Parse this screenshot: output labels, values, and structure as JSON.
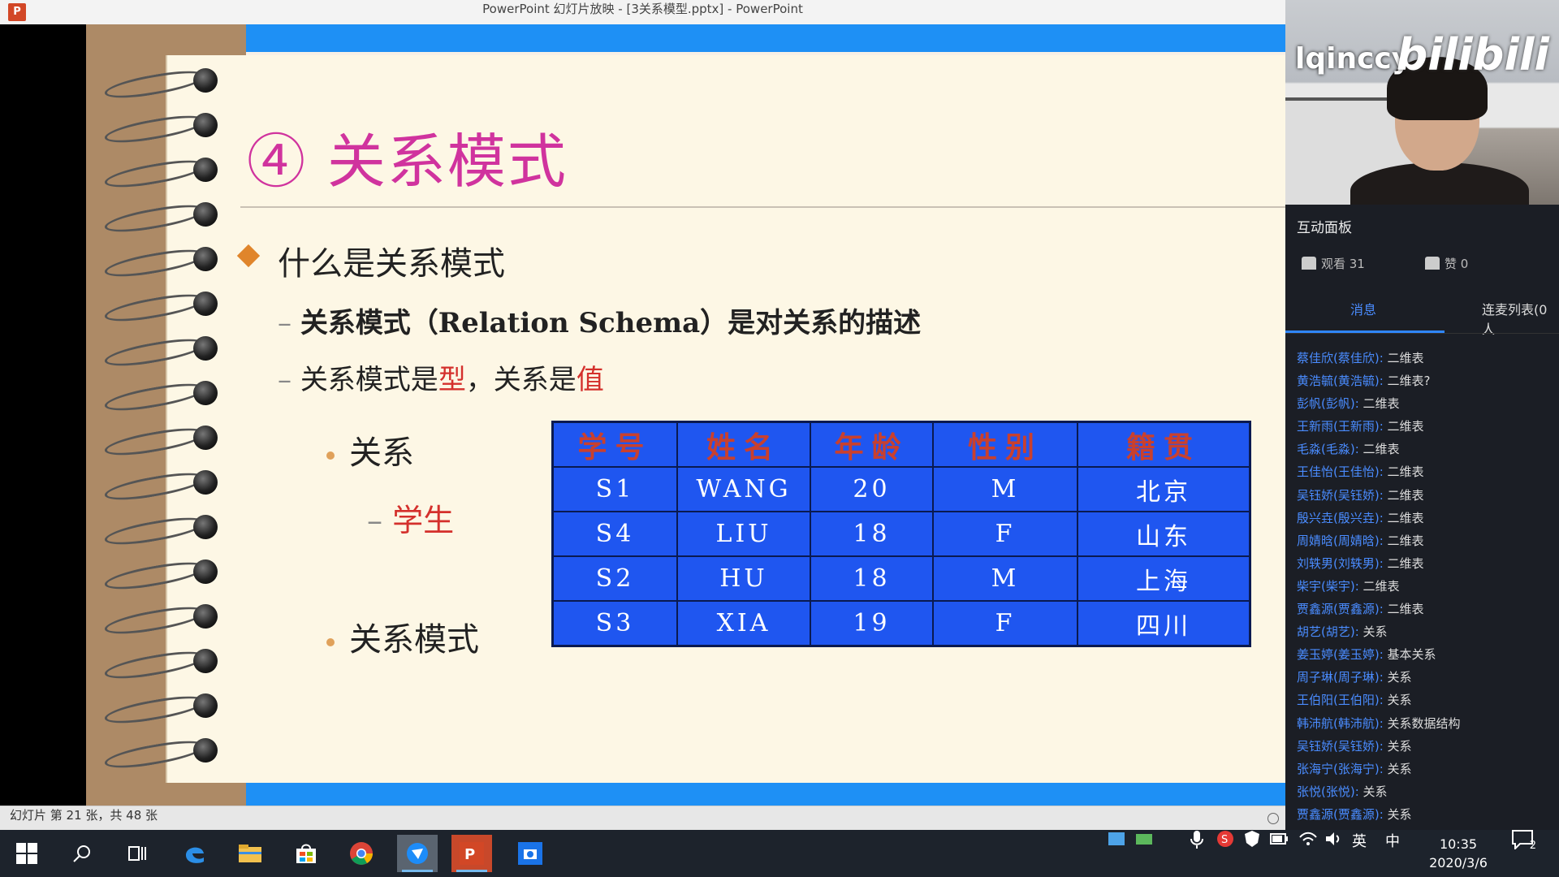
{
  "window": {
    "app_icon": "P",
    "title": "PowerPoint 幻灯片放映 - [3关系模型.pptx] - PowerPoint"
  },
  "slide": {
    "title": "④ 关系模式",
    "bullet1": "什么是关系模式",
    "sub1": "关系模式（Relation Schema）是对关系的描述",
    "sub2_a": "关系模式是",
    "sub2_b": "型",
    "sub2_c": "，关系是",
    "sub2_d": "值",
    "item_relation": "关系",
    "item_student": "学生",
    "item_schema": "关系模式",
    "dash": "–",
    "table": {
      "headers": [
        "学号",
        "姓名",
        "年龄",
        "性别",
        "籍贯"
      ],
      "rows": [
        [
          "S1",
          "WANG",
          "20",
          "M",
          "北京"
        ],
        [
          "S4",
          "LIU",
          "18",
          "F",
          "山东"
        ],
        [
          "S2",
          "HU",
          "18",
          "M",
          "上海"
        ],
        [
          "S3",
          "XIA",
          "19",
          "F",
          "四川"
        ]
      ]
    }
  },
  "statusbar": {
    "text": "幻灯片 第 21 张，共 48 张"
  },
  "live": {
    "username": "lqinccy",
    "logo": "bilibili",
    "panel_title": "互动面板",
    "viewers": "观看 31",
    "likes": "赞 0",
    "tab_messages": "消息",
    "tab_mic_list": "连麦列表(0人",
    "chat": [
      {
        "user": "蔡佳欣(蔡佳欣):",
        "msg": "二维表"
      },
      {
        "user": "黄浩毓(黄浩毓):",
        "msg": "二维表?"
      },
      {
        "user": "彭帆(彭帆):",
        "msg": "二维表"
      },
      {
        "user": "王新雨(王新雨):",
        "msg": "二维表"
      },
      {
        "user": "毛淼(毛淼):",
        "msg": "二维表"
      },
      {
        "user": "王佳怡(王佳怡):",
        "msg": "二维表"
      },
      {
        "user": "吴钰娇(吴钰娇):",
        "msg": "二维表"
      },
      {
        "user": "殷兴垚(殷兴垚):",
        "msg": "二维表"
      },
      {
        "user": "周婧晗(周婧晗):",
        "msg": "二维表"
      },
      {
        "user": "刘轶男(刘轶男):",
        "msg": "二维表"
      },
      {
        "user": "柴宇(柴宇):",
        "msg": "二维表"
      },
      {
        "user": "贾鑫源(贾鑫源):",
        "msg": "二维表"
      },
      {
        "user": "胡艺(胡艺):",
        "msg": "关系"
      },
      {
        "user": "姜玉婷(姜玉婷):",
        "msg": "基本关系"
      },
      {
        "user": "周子琳(周子琳):",
        "msg": "关系"
      },
      {
        "user": "王伯阳(王伯阳):",
        "msg": "关系"
      },
      {
        "user": "韩沛航(韩沛航):",
        "msg": "关系数据结构"
      },
      {
        "user": "吴钰娇(吴钰娇):",
        "msg": "关系"
      },
      {
        "user": "张海宁(张海宁):",
        "msg": "关系"
      },
      {
        "user": "张悦(张悦):",
        "msg": "关系"
      },
      {
        "user": "贾鑫源(贾鑫源):",
        "msg": "关系"
      }
    ]
  },
  "taskbar": {
    "ime": "英",
    "ime_mode": "中",
    "time": "10:35",
    "date": "2020/3/6",
    "notifications": "2"
  }
}
